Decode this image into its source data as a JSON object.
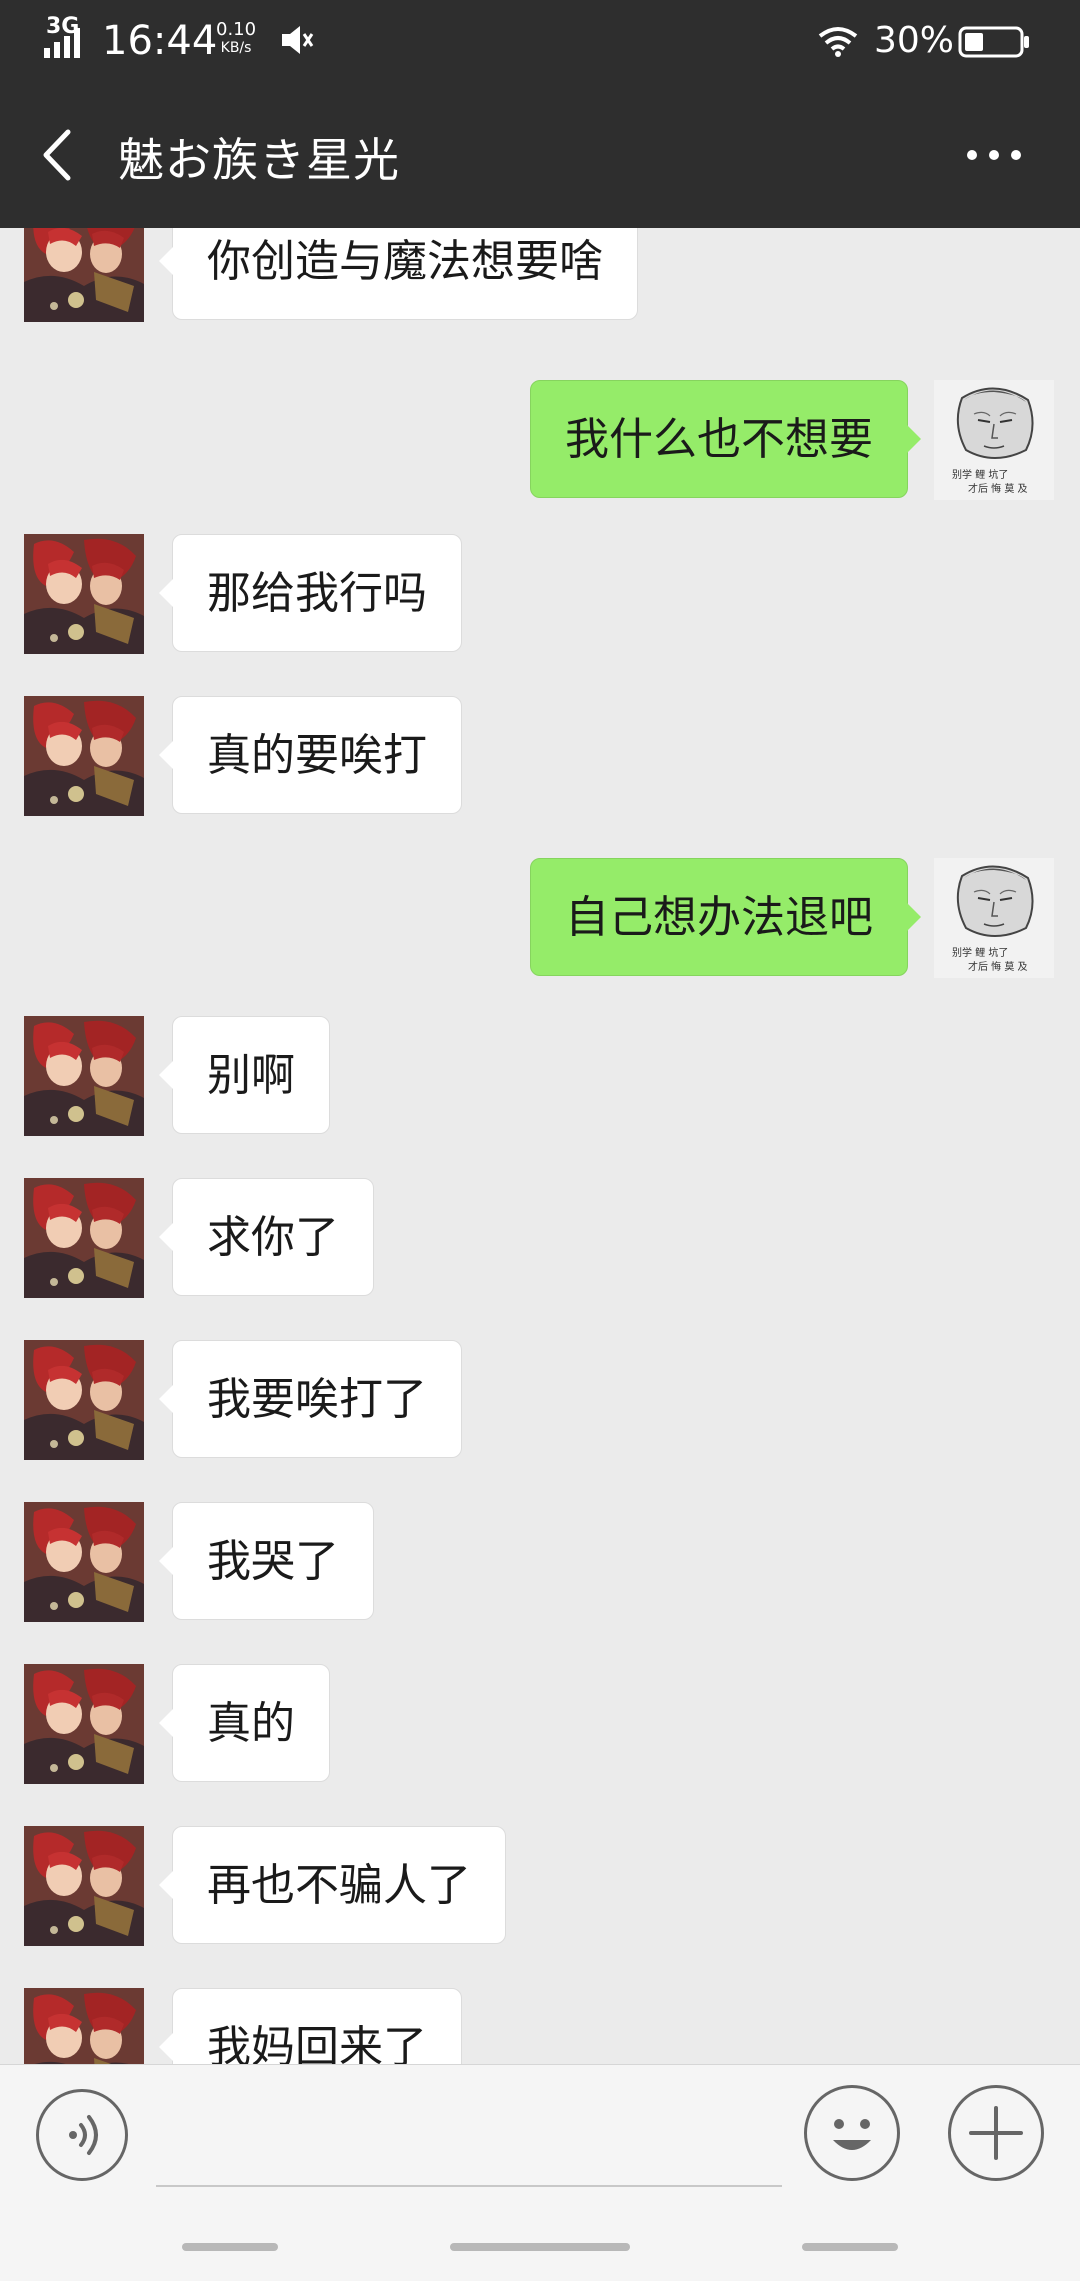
{
  "status_bar": {
    "network": "3G",
    "time": "16:44",
    "speed_value": "0.10",
    "speed_unit": "KB/s",
    "battery": "30%",
    "icons": [
      "signal-icon",
      "mute-icon",
      "wifi-icon",
      "battery-icon"
    ]
  },
  "header": {
    "title": "魅お族き星光",
    "back_icon": "chevron-left-icon",
    "more_icon": "more-dots-icon"
  },
  "messages": [
    {
      "side": "left",
      "text": "你创造与魔法想要啥"
    },
    {
      "side": "right",
      "text": "我什么也不想要"
    },
    {
      "side": "left",
      "text": "那给我行吗"
    },
    {
      "side": "left",
      "text": "真的要唉打"
    },
    {
      "side": "right",
      "text": "自己想办法退吧"
    },
    {
      "side": "left",
      "text": "别啊"
    },
    {
      "side": "left",
      "text": "求你了"
    },
    {
      "side": "left",
      "text": "我要唉打了"
    },
    {
      "side": "left",
      "text": "我哭了"
    },
    {
      "side": "left",
      "text": "真的"
    },
    {
      "side": "left",
      "text": "再也不骗人了"
    },
    {
      "side": "left",
      "text": "我妈回来了"
    }
  ],
  "input_bar": {
    "voice_icon": "voice-icon",
    "emoji_icon": "emoji-icon",
    "plus_icon": "plus-icon",
    "value": ""
  },
  "colors": {
    "header_bg": "#2e2e2e",
    "chat_bg": "#ebebeb",
    "sent_bubble": "#95ec69",
    "received_bubble": "#ffffff"
  }
}
